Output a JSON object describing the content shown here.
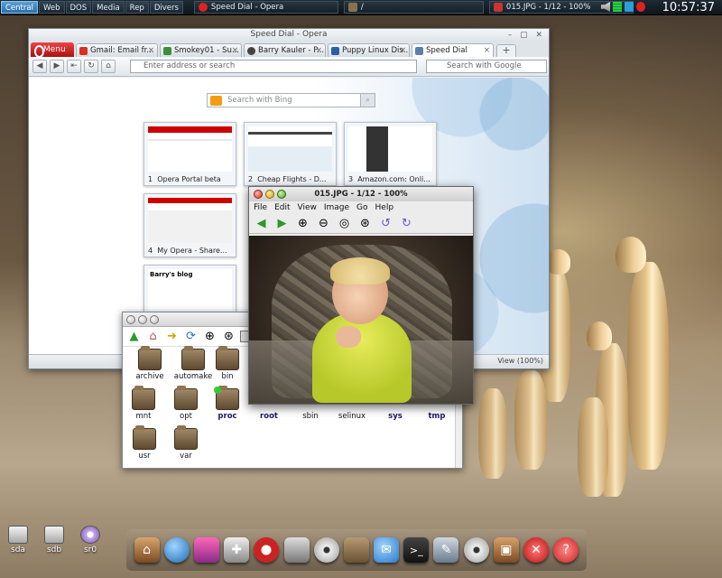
{
  "taskbar": {
    "workspaces": [
      "Central",
      "Web",
      "DOS",
      "Media",
      "Rep",
      "Divers"
    ],
    "active_workspace": "Central",
    "tasks": [
      {
        "label": "Speed Dial - Opera",
        "icon": "opera-icon"
      },
      {
        "label": "/",
        "icon": "folder-icon"
      },
      {
        "label": "015.JPG - 1/12 - 100%",
        "icon": "viewer-icon"
      }
    ],
    "clock": "10:57:37"
  },
  "opera": {
    "title": "Speed Dial - Opera",
    "menu_label": "Menu",
    "tabs": [
      {
        "label": "Gmail: Email fr...",
        "color": "#d93025"
      },
      {
        "label": "Smokey01 - Su...",
        "color": "#3a8f3a"
      },
      {
        "label": "Barry Kauler - P...",
        "color": "#444444"
      },
      {
        "label": "Puppy Linux Dis...",
        "color": "#2b5fa8"
      },
      {
        "label": "Speed Dial",
        "color": "#5a7fa8"
      }
    ],
    "address_placeholder": "Enter address or search",
    "search_placeholder": "Search with Google",
    "bing_placeholder": "Search with Bing",
    "speed_dials": [
      {
        "num": "1",
        "caption": "Opera Portal beta"
      },
      {
        "num": "2",
        "caption": "Cheap Flights - D..."
      },
      {
        "num": "3",
        "caption": "Amazon.com: Onli..."
      },
      {
        "num": "4",
        "caption": "My Opera - Share..."
      },
      {
        "num": "",
        "caption": ""
      }
    ],
    "dial5_heading": "Barry's blog",
    "zoom": "View (100%)"
  },
  "filemanager": {
    "folders": [
      "archive",
      "automake",
      "bin",
      "mnt",
      "opt",
      "proc",
      "root",
      "sbin",
      "selinux",
      "sys",
      "tmp",
      "usr",
      "var"
    ],
    "bold_folders": [
      "proc",
      "root",
      "sys",
      "tmp"
    ]
  },
  "viewer": {
    "title": "015.JPG - 1/12 - 100%",
    "menu": [
      "File",
      "Edit",
      "View",
      "Image",
      "Go",
      "Help"
    ]
  },
  "desktop": {
    "drives": [
      "sda",
      "sdb",
      "sr0"
    ],
    "dock_icons": [
      "home-icon",
      "globe-icon",
      "paint-icon",
      "puzzle-icon",
      "opera-icon",
      "drive-icon",
      "film-icon",
      "folder-icon",
      "chat-icon",
      "terminal-icon",
      "editor-icon",
      "media-icon",
      "package-icon",
      "shutdown-icon",
      "help-icon"
    ]
  }
}
